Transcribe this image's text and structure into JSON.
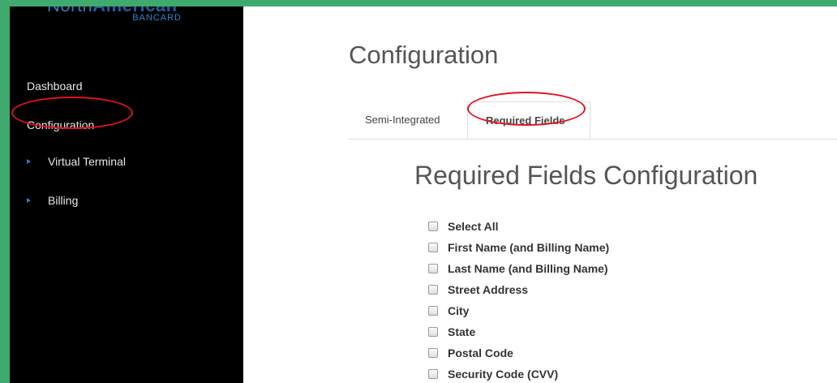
{
  "brand": {
    "name_part1": "North",
    "name_part2": "American",
    "name_sub": "BANCARD"
  },
  "sidebar": {
    "items": [
      {
        "label": "Dashboard"
      },
      {
        "label": "Configuration"
      }
    ],
    "sub_items": [
      {
        "label": "Virtual Terminal"
      },
      {
        "label": "Billing"
      }
    ]
  },
  "main": {
    "title": "Configuration",
    "tabs": [
      {
        "label": "Semi-Integrated",
        "active": false
      },
      {
        "label": "Required Fields",
        "active": true
      }
    ],
    "section_title": "Required Fields Configuration",
    "fields": [
      {
        "label": "Select All",
        "checked": false
      },
      {
        "label": "First Name (and Billing Name)",
        "checked": false
      },
      {
        "label": "Last Name (and Billing Name)",
        "checked": false
      },
      {
        "label": "Street Address",
        "checked": false
      },
      {
        "label": "City",
        "checked": false
      },
      {
        "label": "State",
        "checked": false
      },
      {
        "label": "Postal Code",
        "checked": false
      },
      {
        "label": "Security Code (CVV)",
        "checked": false
      }
    ]
  },
  "colors": {
    "frame": "#3eaa6e",
    "sidebar_bg": "#000000",
    "annotation": "#e0141e",
    "bullet": "#2b7fd1"
  }
}
